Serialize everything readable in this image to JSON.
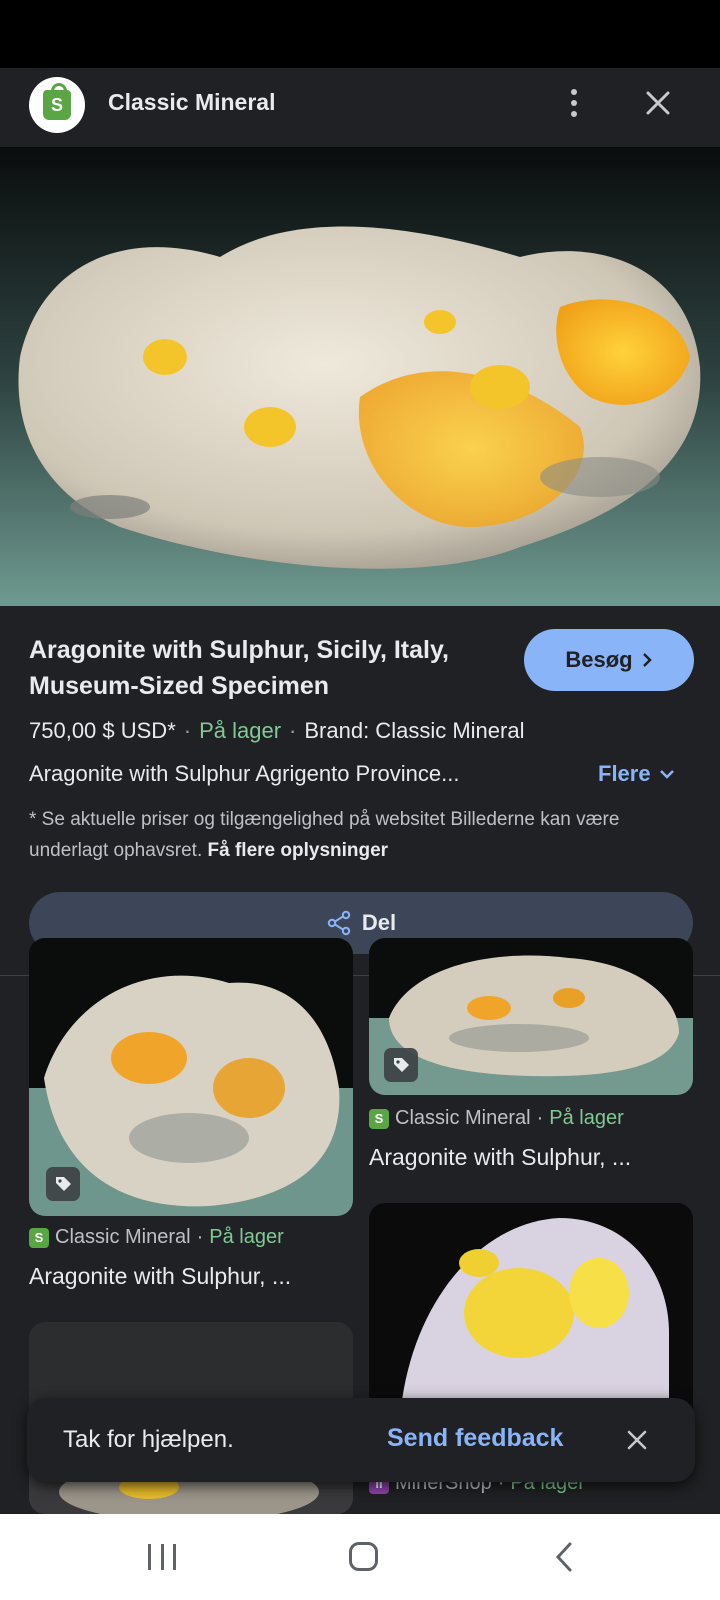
{
  "header": {
    "site_name": "Classic Mineral",
    "logo_letter": "S",
    "more_icon": "more-vert-icon",
    "close_icon": "close-icon"
  },
  "product": {
    "title": "Aragonite with Sulphur, Sicily, Italy, Museum-Sized Specimen",
    "visit_label": "Besøg",
    "price": "750,00 $ USD*",
    "availability": "På lager",
    "brand": "Brand: Classic Mineral",
    "description": "Aragonite with Sulphur Agrigento Province...",
    "more_label": "Flere",
    "disclaimer": "* Se aktuelle priser og tilgængelighed på websitet Billederne kan være underlagt ophavsret.",
    "disclaimer_link": "Få flere oplysninger",
    "share_label": "Del"
  },
  "related": [
    {
      "source": "Classic Mineral",
      "availability": "På lager",
      "title": "Aragonite with Sulphur, ..."
    },
    {
      "source": "Classic Mineral",
      "availability": "På lager",
      "title": "Aragonite with Sulphur, ..."
    },
    {
      "source": "MinerShop",
      "availability": "På lager",
      "title": ""
    }
  ],
  "snackbar": {
    "message": "Tak for hjælpen.",
    "action": "Send feedback"
  },
  "colors": {
    "background": "#202124",
    "accent": "#8ab4f8",
    "in_stock": "#81c995",
    "share_button": "#3c4658"
  }
}
